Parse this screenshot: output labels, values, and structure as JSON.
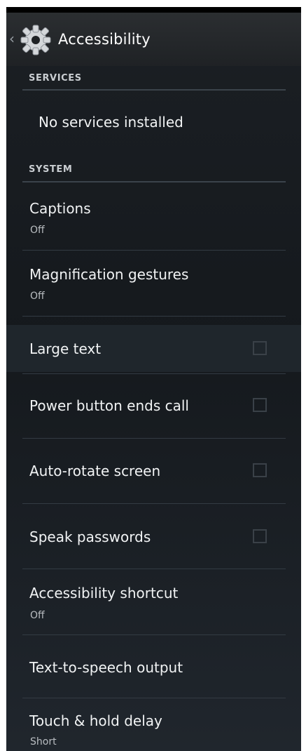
{
  "action_bar": {
    "title": "Accessibility"
  },
  "services": {
    "header": "SERVICES",
    "empty_text": "No services installed"
  },
  "system": {
    "header": "SYSTEM",
    "items": [
      {
        "title": "Captions",
        "summary": "Off"
      },
      {
        "title": "Magnification gestures",
        "summary": "Off"
      },
      {
        "title": "Large text",
        "checked": false
      },
      {
        "title": "Power button ends call",
        "checked": false
      },
      {
        "title": "Auto-rotate screen",
        "checked": false
      },
      {
        "title": "Speak passwords",
        "checked": false
      },
      {
        "title": "Accessibility shortcut",
        "summary": "Off"
      },
      {
        "title": "Text-to-speech output"
      },
      {
        "title": "Touch & hold delay",
        "summary": "Short"
      }
    ]
  },
  "icons": {
    "back": "chevron-left-icon",
    "app": "gear-icon",
    "checkbox": "checkbox-unchecked-icon"
  }
}
